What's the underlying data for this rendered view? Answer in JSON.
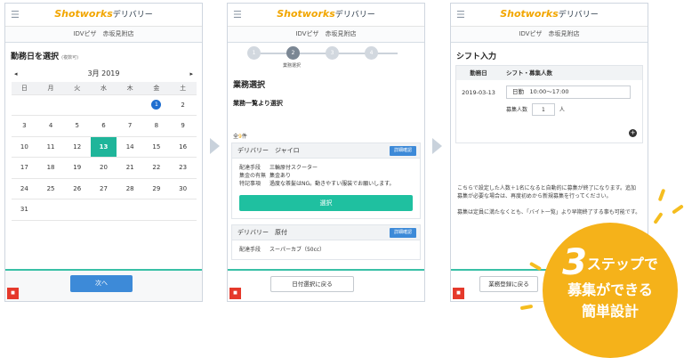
{
  "brand": {
    "name_en": "Shotworks",
    "name_jp": "デリバリー"
  },
  "shop_name": "IDVピザ　赤坂見附店",
  "screen1": {
    "title": "勤務日を選択",
    "title_note": "(複数可)",
    "month": "3月 2019",
    "prev_icon": "◂",
    "next_icon": "▸",
    "weekdays": [
      "日",
      "月",
      "火",
      "水",
      "木",
      "金",
      "土"
    ],
    "badge_count": "1",
    "next_button": "次へ"
  },
  "screen2": {
    "steps": [
      "1",
      "2",
      "3",
      "4"
    ],
    "active_step_label": "業務選択",
    "title": "業務選択",
    "subtitle": "業務一覧より選択",
    "count_prefix": "全",
    "count_num": "9",
    "count_suffix": "件",
    "job1": {
      "title": "デリバリー　ジャイロ",
      "detail": "詳細確認",
      "rows": [
        {
          "k": "配達手段",
          "v": "三輪原付スクーター"
        },
        {
          "k": "集金の有無",
          "v": "集金あり"
        },
        {
          "k": "特記事項",
          "v": "過度な茶髪はNG。動きやすい服装でお願いします。"
        }
      ],
      "select": "選択"
    },
    "job2": {
      "title": "デリバリー　原付",
      "detail": "詳細確認",
      "row1_k": "配達手段",
      "row1_v": "スーパーカブ（50cc）"
    },
    "back_button": "日付選択に戻る"
  },
  "screen3": {
    "title": "シフト入力",
    "col_date": "勤務日",
    "col_shift": "シフト・募集人数",
    "date": "2019-03-13",
    "time": "日勤　10:00〜17:00",
    "recruit_label": "募集人数",
    "recruit_value": "1",
    "recruit_unit": "人",
    "note1": "こちらで設定した人数＋1名になると自動的に募集が終了になります。追加募集が必要な場合は、再度初めから新規募集を行ってください。",
    "note2": "募集は定員に満たなくとも、「バイト一覧」より早期終了する事も可能です。",
    "back_button": "業務登録に戻る"
  },
  "promo": {
    "num": "3",
    "line1": "ステップで",
    "line2": "募集ができる",
    "line3": "簡単設計"
  },
  "colors": {
    "accent_green": "#1fb59a",
    "accent_blue": "#3d8ad8",
    "brand_orange": "#f2a600",
    "promo_yellow": "#f5b21a"
  }
}
